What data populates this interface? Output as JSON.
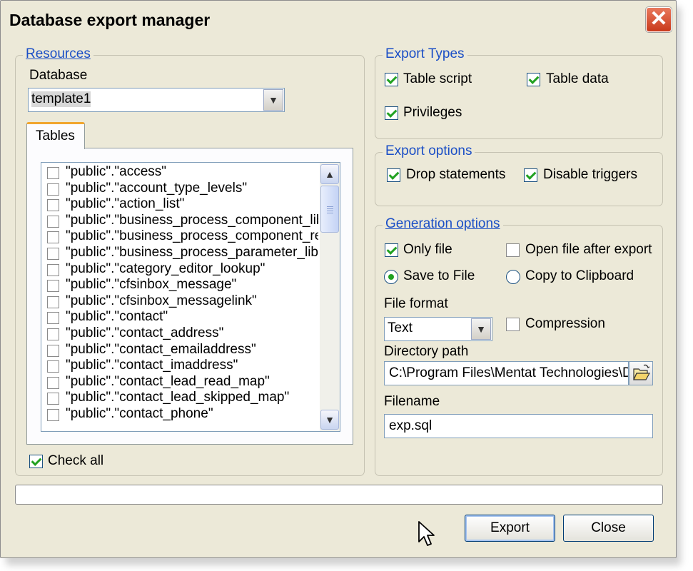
{
  "window": {
    "title": "Database export manager",
    "close_glyph": "✕"
  },
  "resources": {
    "legend": "Resources",
    "database_label": "Database",
    "database_value": "template1",
    "tab_label": "Tables",
    "tables": [
      {
        "name": "\"public\".\"access\"",
        "checked": false
      },
      {
        "name": "\"public\".\"account_type_levels\"",
        "checked": false
      },
      {
        "name": "\"public\".\"action_list\"",
        "checked": false
      },
      {
        "name": "\"public\".\"business_process_component_lib",
        "checked": false
      },
      {
        "name": "\"public\".\"business_process_component_re",
        "checked": false
      },
      {
        "name": "\"public\".\"business_process_parameter_libr",
        "checked": false
      },
      {
        "name": "\"public\".\"category_editor_lookup\"",
        "checked": false
      },
      {
        "name": "\"public\".\"cfsinbox_message\"",
        "checked": false
      },
      {
        "name": "\"public\".\"cfsinbox_messagelink\"",
        "checked": false
      },
      {
        "name": "\"public\".\"contact\"",
        "checked": false
      },
      {
        "name": "\"public\".\"contact_address\"",
        "checked": false
      },
      {
        "name": "\"public\".\"contact_emailaddress\"",
        "checked": false
      },
      {
        "name": "\"public\".\"contact_imaddress\"",
        "checked": false
      },
      {
        "name": "\"public\".\"contact_lead_read_map\"",
        "checked": false
      },
      {
        "name": "\"public\".\"contact_lead_skipped_map\"",
        "checked": false
      },
      {
        "name": "\"public\".\"contact_phone\"",
        "checked": false
      }
    ],
    "check_all_label": "Check all",
    "check_all_checked": true
  },
  "export_types": {
    "legend": "Export Types",
    "table_script": "Table script",
    "table_data": "Table data",
    "privileges": "Privileges"
  },
  "export_options": {
    "legend": "Export options",
    "drop_statements": "Drop statements",
    "disable_triggers": "Disable triggers"
  },
  "generation_options": {
    "legend": "Generation options",
    "only_file": "Only file",
    "open_file_after_export": "Open file after export",
    "save_to_file": "Save to File",
    "copy_to_clipboard": "Copy to Clipboard",
    "file_format_label": "File format",
    "file_format_value": "Text",
    "compression": "Compression",
    "directory_path_label": "Directory path",
    "directory_path_value": "C:\\Program Files\\Mentat Technologies\\D",
    "filename_label": "Filename",
    "filename_value": "exp.sql"
  },
  "buttons": {
    "export": "Export",
    "close": "Close"
  },
  "icons": {
    "dropdown": "chevron-down-icon",
    "scroll_up": "scroll-up-arrow-icon",
    "scroll_down": "scroll-down-arrow-icon",
    "folder": "folder-open-icon",
    "cursor": "mouse-pointer-icon"
  },
  "colors": {
    "accent_legend": "#1b4fc6",
    "check_green": "#21a121",
    "close_red": "#d54a2a"
  }
}
